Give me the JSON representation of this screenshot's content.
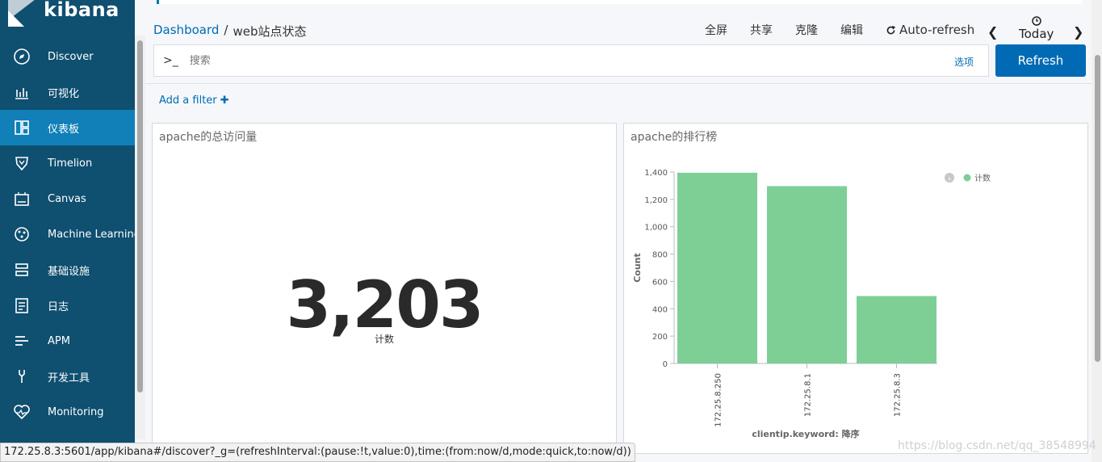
{
  "app": {
    "brand": "kibana"
  },
  "sidebar": {
    "items": [
      {
        "label": "Discover",
        "icon": "compass-icon"
      },
      {
        "label": "可视化",
        "icon": "visualize-icon"
      },
      {
        "label": "仪表板",
        "icon": "dashboard-icon",
        "active": true
      },
      {
        "label": "Timelion",
        "icon": "timelion-icon"
      },
      {
        "label": "Canvas",
        "icon": "canvas-icon"
      },
      {
        "label": "Machine Learning",
        "icon": "machine-learning-icon"
      },
      {
        "label": "基础设施",
        "icon": "infrastructure-icon"
      },
      {
        "label": "日志",
        "icon": "logs-icon"
      },
      {
        "label": "APM",
        "icon": "apm-icon"
      },
      {
        "label": "开发工具",
        "icon": "dev-tools-icon"
      },
      {
        "label": "Monitoring",
        "icon": "monitoring-icon"
      }
    ]
  },
  "breadcrumb": {
    "root": "Dashboard",
    "separator": "/",
    "current": "web站点状态"
  },
  "topmenu": {
    "fullscreen": "全屏",
    "share": "共享",
    "clone": "克隆",
    "edit": "编辑",
    "auto_refresh": "Auto-refresh",
    "time_label": "Today"
  },
  "search": {
    "prompt": ">_",
    "placeholder": "搜索",
    "options": "选项",
    "refresh": "Refresh"
  },
  "filter": {
    "add_label": "Add a filter"
  },
  "panels": {
    "metric": {
      "title": "apache的总访问量",
      "value": "3,203",
      "label": "计数"
    },
    "bar": {
      "title": "apache的排行榜"
    }
  },
  "chart_data": {
    "type": "bar",
    "title": "apache的排行榜",
    "categories": [
      "172.25.8.250",
      "172.25.8.1",
      "172.25.8.3"
    ],
    "series": [
      {
        "name": "计数",
        "values": [
          1395,
          1297,
          493
        ],
        "color": "#7dcf96"
      }
    ],
    "xlabel": "clientip.keyword: 降序",
    "ylabel": "Count",
    "ylim": [
      0,
      1400
    ],
    "yticks": [
      0,
      200,
      400,
      600,
      800,
      1000,
      1200,
      1400
    ],
    "ytick_labels": [
      "0",
      "200",
      "400",
      "600",
      "800",
      "1,000",
      "1,200",
      "1,400"
    ],
    "legend": "top-right",
    "grid": false
  },
  "status_url": "172.25.8.3:5601/app/kibana#/discover?_g=(refreshInterval:(pause:!t,value:0),time:(from:now/d,mode:quick,to:now/d))",
  "watermark": "https://blog.csdn.net/qq_38548994"
}
